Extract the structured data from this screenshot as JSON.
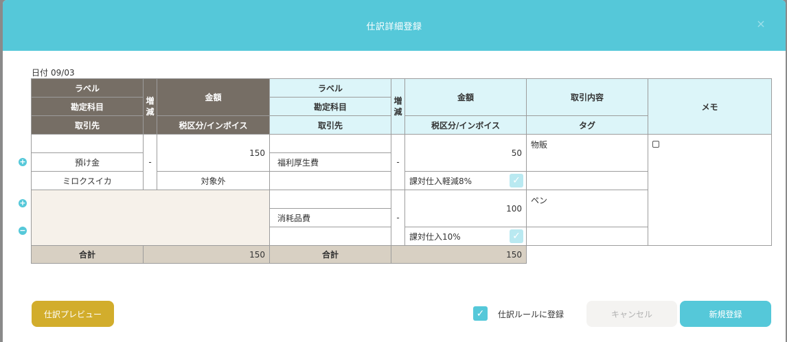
{
  "modal": {
    "title": "仕訳詳細登録",
    "close_icon": "×"
  },
  "date": {
    "label": "日付",
    "value": "09/03"
  },
  "headers": {
    "debit": {
      "label": "ラベル",
      "account": "勘定科目",
      "partner": "取引先",
      "inc_dec": [
        "増",
        "減"
      ],
      "amount": "金額",
      "tax": "税区分/インボイス"
    },
    "credit": {
      "label": "ラベル",
      "account": "勘定科目",
      "partner": "取引先",
      "inc_dec": [
        "増",
        "減"
      ],
      "amount": "金額",
      "tax": "税区分/インボイス",
      "content": "取引内容",
      "tag": "タグ",
      "memo": "メモ"
    }
  },
  "debit_rows": [
    {
      "label": "",
      "account": "預け金",
      "partner": "ミロクスイカ",
      "inc_dec": "-",
      "amount": "150",
      "tax": "対象外"
    }
  ],
  "credit_rows": [
    {
      "label": "",
      "account": "福利厚生費",
      "partner": "",
      "inc_dec": "-",
      "amount": "50",
      "tax": "課対仕入軽減8%",
      "content": "物販",
      "tag": "",
      "checked": true
    },
    {
      "label": "",
      "account": "消耗品費",
      "partner": "",
      "inc_dec": "-",
      "amount": "100",
      "tax": "課対仕入10%",
      "content": "ペン",
      "tag": "",
      "checked": true
    }
  ],
  "totals": {
    "debit_label": "合計",
    "debit_value": "150",
    "credit_label": "合計",
    "credit_value": "150"
  },
  "row_buttons": {
    "add_icon": "+",
    "remove_icon": "−"
  },
  "footer": {
    "preview_label": "仕訳プレビュー",
    "rule_label": "仕訳ルールに登録",
    "rule_checked": true,
    "cancel_label": "キャンセル",
    "register_label": "新規登録"
  },
  "colors": {
    "accent": "#55c8d9",
    "dark_header": "#766e65",
    "light_header": "#dcf5f9",
    "preview_button": "#d2ad2c"
  }
}
